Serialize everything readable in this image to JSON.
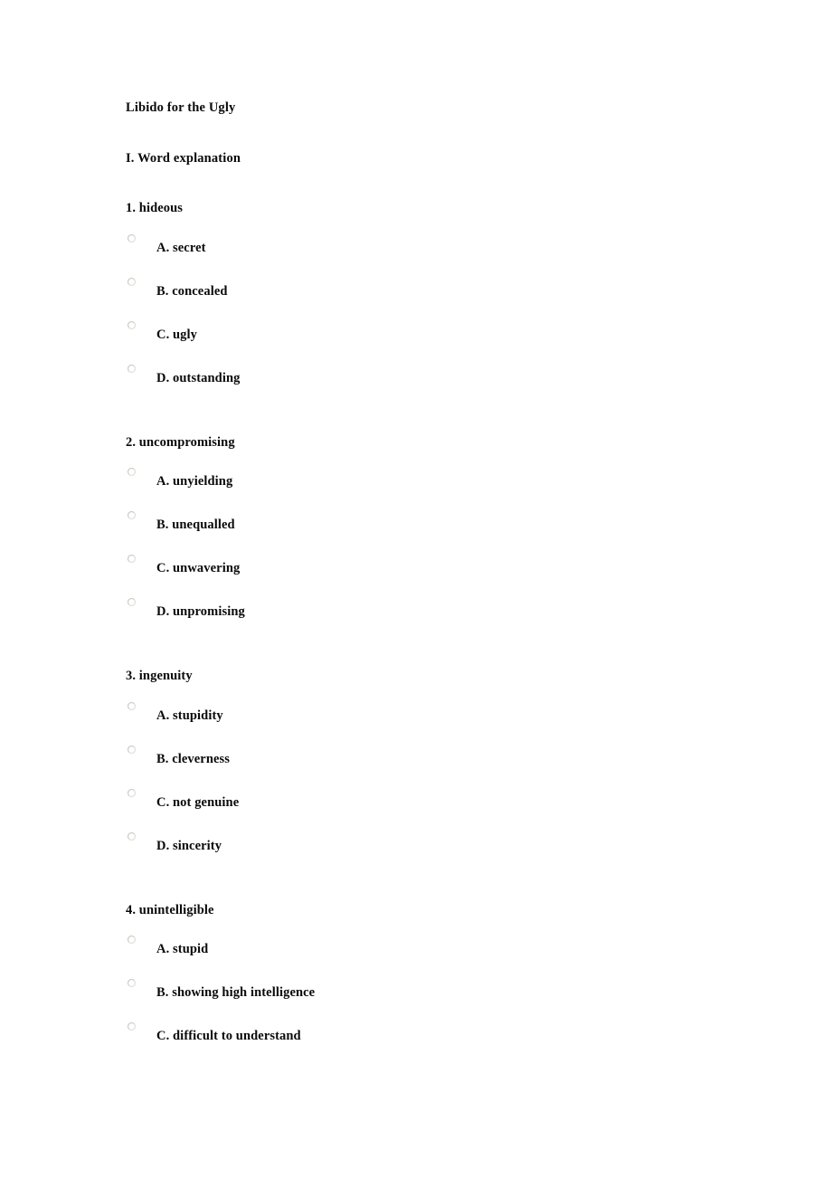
{
  "document": {
    "title": "Libido for the Ugly",
    "section_heading": "I. Word explanation",
    "questions": [
      {
        "number": "1.",
        "prompt": "1. hideous",
        "options": [
          {
            "label": "A. secret",
            "value": "A",
            "selected": false,
            "control": "radio-button"
          },
          {
            "label": "B. concealed",
            "value": "B",
            "selected": false,
            "control": "radio-button"
          },
          {
            "label": "C. ugly",
            "value": "C",
            "selected": false,
            "control": "radio-button"
          },
          {
            "label": "D. outstanding",
            "value": "D",
            "selected": false,
            "control": "radio-button"
          }
        ]
      },
      {
        "number": "2.",
        "prompt": "2. uncompromising",
        "options": [
          {
            "label": "A. unyielding",
            "value": "A",
            "selected": false,
            "control": "radio-button"
          },
          {
            "label": "B. unequalled",
            "value": "B",
            "selected": false,
            "control": "radio-button"
          },
          {
            "label": "C. unwavering",
            "value": "C",
            "selected": false,
            "control": "radio-button"
          },
          {
            "label": "D. unpromising",
            "value": "D",
            "selected": false,
            "control": "radio-button"
          }
        ]
      },
      {
        "number": "3.",
        "prompt": "3. ingenuity",
        "options": [
          {
            "label": "A. stupidity",
            "value": "A",
            "selected": false,
            "control": "radio-button"
          },
          {
            "label": "B. cleverness",
            "value": "B",
            "selected": false,
            "control": "radio-button"
          },
          {
            "label": "C. not genuine",
            "value": "C",
            "selected": false,
            "control": "radio-button"
          },
          {
            "label": "D. sincerity",
            "value": "D",
            "selected": false,
            "control": "radio-button"
          }
        ]
      },
      {
        "number": "4.",
        "prompt": "4. unintelligible",
        "options": [
          {
            "label": "A. stupid",
            "value": "A",
            "selected": false,
            "control": "radio-button"
          },
          {
            "label": "B. showing high intelligence",
            "value": "B",
            "selected": false,
            "control": "radio-button"
          },
          {
            "label": "C. difficult to understand",
            "value": "C",
            "selected": false,
            "control": "radio-button"
          }
        ]
      }
    ]
  },
  "colors": {
    "page_background": "#ffffff",
    "text": "#0a0a0a",
    "radio_ring": "#b9b7b0",
    "radio_fill": "#ffffff"
  }
}
